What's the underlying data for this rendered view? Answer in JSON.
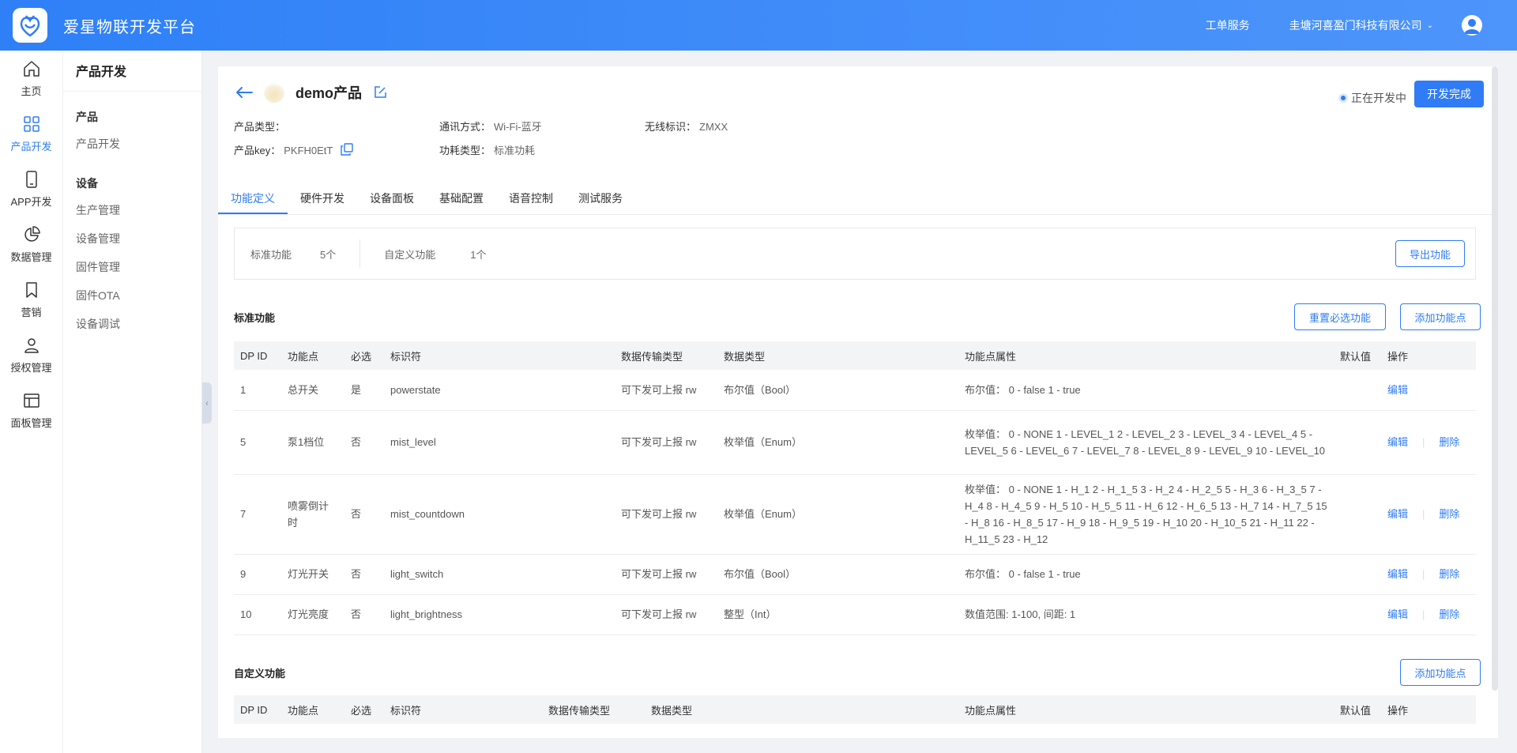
{
  "app": {
    "title": "爱星物联开发平台",
    "work_order": "工单服务",
    "company": "圭塘河喜盈门科技有限公司"
  },
  "rail": [
    {
      "label": "主页",
      "icon": "home-icon"
    },
    {
      "label": "产品开发",
      "icon": "grid-icon"
    },
    {
      "label": "APP开发",
      "icon": "phone-icon"
    },
    {
      "label": "数据管理",
      "icon": "pie-chart-icon"
    },
    {
      "label": "营销",
      "icon": "bookmark-icon"
    },
    {
      "label": "授权管理",
      "icon": "user-icon"
    },
    {
      "label": "面板管理",
      "icon": "panel-icon"
    }
  ],
  "subnav": {
    "title": "产品开发",
    "group_product": "产品",
    "product_items": [
      "产品开发"
    ],
    "group_device": "设备",
    "device_items": [
      "生产管理",
      "设备管理",
      "固件管理",
      "固件OTA",
      "设备调试"
    ]
  },
  "product": {
    "name": "demo产品",
    "status": "正在开发中",
    "finish_label": "开发完成",
    "type_label": "产品类型：",
    "type_value": "",
    "comm_label": "通讯方式：",
    "comm_value": "Wi-Fi-蓝牙",
    "wireless_label": "无线标识：",
    "wireless_value": "ZMXX",
    "key_label": "产品key：",
    "key_value": "PKFH0EtT",
    "power_label": "功耗类型：",
    "power_value": "标准功耗"
  },
  "tabs": [
    "功能定义",
    "硬件开发",
    "设备面板",
    "基础配置",
    "语音控制",
    "测试服务"
  ],
  "summary": {
    "std_label": "标准功能",
    "std_count": "5个",
    "custom_label": "自定义功能",
    "custom_count": "1个",
    "export_label": "导出功能"
  },
  "standard": {
    "title": "标准功能",
    "reset_label": "重置必选功能",
    "add_label": "添加功能点",
    "columns": [
      "DP ID",
      "功能点",
      "必选",
      "标识符",
      "数据传输类型",
      "数据类型",
      "功能点属性",
      "默认值",
      "操作"
    ],
    "rows": [
      {
        "id": "1",
        "name": "总开关",
        "required": "是",
        "identifier": "powerstate",
        "transfer": "可下发可上报 rw",
        "dtype": "布尔值（Bool）",
        "attr": "布尔值：   0 - false 1 - true",
        "default": "",
        "edit": "编辑",
        "delete": ""
      },
      {
        "id": "5",
        "name": "泵1档位",
        "required": "否",
        "identifier": "mist_level",
        "transfer": "可下发可上报 rw",
        "dtype": "枚举值（Enum）",
        "attr": "枚举值：   0 - NONE 1 - LEVEL_1 2 - LEVEL_2 3 - LEVEL_3 4 - LEVEL_4 5 - LEVEL_5 6 - LEVEL_6 7 - LEVEL_7 8 - LEVEL_8 9 - LEVEL_9 10 - LEVEL_10",
        "default": "",
        "edit": "编辑",
        "delete": "删除"
      },
      {
        "id": "7",
        "name": "喷雾倒计时",
        "required": "否",
        "identifier": "mist_countdown",
        "transfer": "可下发可上报 rw",
        "dtype": "枚举值（Enum）",
        "attr": "枚举值：   0 - NONE 1 - H_1 2 - H_1_5 3 - H_2 4 - H_2_5 5 - H_3 6 - H_3_5 7 - H_4 8 - H_4_5 9 - H_5 10 - H_5_5 11 - H_6 12 - H_6_5 13 - H_7 14 - H_7_5 15 - H_8 16 - H_8_5 17 - H_9 18 - H_9_5 19 - H_10 20 - H_10_5 21 - H_11 22 - H_11_5 23 - H_12",
        "default": "",
        "edit": "编辑",
        "delete": "删除"
      },
      {
        "id": "9",
        "name": "灯光开关",
        "required": "否",
        "identifier": "light_switch",
        "transfer": "可下发可上报 rw",
        "dtype": "布尔值（Bool）",
        "attr": "布尔值：   0 - false 1 - true",
        "default": "",
        "edit": "编辑",
        "delete": "删除"
      },
      {
        "id": "10",
        "name": "灯光亮度",
        "required": "否",
        "identifier": "light_brightness",
        "transfer": "可下发可上报 rw",
        "dtype": "整型（Int）",
        "attr": "数值范围: 1-100, 间距: 1",
        "default": "",
        "edit": "编辑",
        "delete": "删除"
      }
    ]
  },
  "custom": {
    "title": "自定义功能",
    "add_label": "添加功能点",
    "columns": [
      "DP ID",
      "功能点",
      "必选",
      "标识符",
      "数据传输类型",
      "数据类型",
      "功能点属性",
      "默认值",
      "操作"
    ]
  },
  "colors": {
    "accent": "#2f7cf6",
    "topbar_start": "#2f80f7",
    "topbar_end": "#4d95fb"
  }
}
